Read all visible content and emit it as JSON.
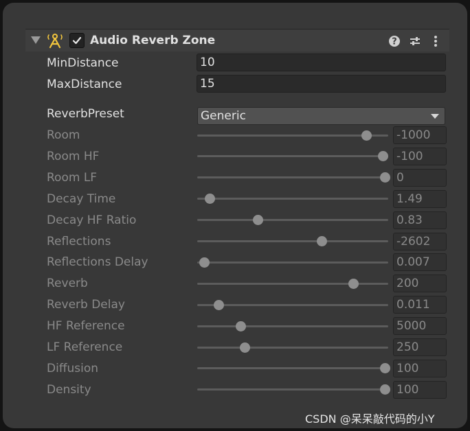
{
  "component": {
    "title": "Audio Reverb Zone",
    "enabled": true,
    "icons": [
      "foldout-arrow-icon",
      "audio-reverb-zone-icon",
      "help-icon",
      "preset-icon",
      "kebab-menu-icon"
    ]
  },
  "fields": {
    "min_distance": {
      "label": "MinDistance",
      "value": "10"
    },
    "max_distance": {
      "label": "MaxDistance",
      "value": "15"
    },
    "reverb_preset": {
      "label": "ReverbPreset",
      "value": "Generic"
    }
  },
  "sliders": [
    {
      "label": "Room",
      "value": "-1000",
      "fraction": 0.9
    },
    {
      "label": "Room HF",
      "value": "-100",
      "fraction": 0.99
    },
    {
      "label": "Room LF",
      "value": "0",
      "fraction": 1.0
    },
    {
      "label": "Decay Time",
      "value": "1.49",
      "fraction": 0.05
    },
    {
      "label": "Decay HF Ratio",
      "value": "0.83",
      "fraction": 0.31
    },
    {
      "label": "Reflections",
      "value": "-2602",
      "fraction": 0.66
    },
    {
      "label": "Reflections Delay",
      "value": "0.007",
      "fraction": 0.02
    },
    {
      "label": "Reverb",
      "value": "200",
      "fraction": 0.83
    },
    {
      "label": "Reverb Delay",
      "value": "0.011",
      "fraction": 0.1
    },
    {
      "label": "HF Reference",
      "value": "5000",
      "fraction": 0.22
    },
    {
      "label": "LF Reference",
      "value": "250",
      "fraction": 0.24
    },
    {
      "label": "Diffusion",
      "value": "100",
      "fraction": 1.0
    },
    {
      "label": "Density",
      "value": "100",
      "fraction": 1.0
    }
  ],
  "colors": {
    "panel": "#383838",
    "header": "#3e3e3e",
    "field": "#2a2a2a",
    "dropdown": "#515151",
    "icon_yellow": "#f2c53d"
  },
  "watermark": "CSDN @呆呆敲代码的小Y"
}
